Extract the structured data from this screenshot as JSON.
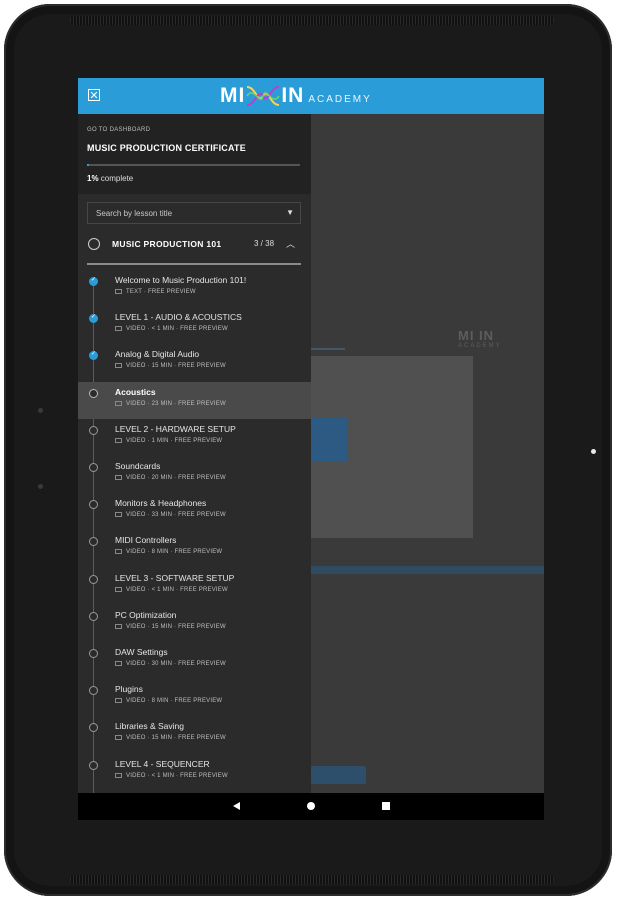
{
  "app": {
    "brand_left": "MI",
    "brand_right": "IN",
    "brand_suffix": "ACADEMY",
    "close_glyph": "✕",
    "accent_color": "#2a9dd9"
  },
  "sidebar": {
    "go_dashboard": "GO TO DASHBOARD",
    "course_title": "MUSIC PRODUCTION CERTIFICATE",
    "progress_percent": 1,
    "complete_value": "1%",
    "complete_label": " complete",
    "search_placeholder": "Search by lesson title",
    "section": {
      "title": "MUSIC PRODUCTION 101",
      "count": "3 / 38"
    },
    "lessons": [
      {
        "title": "Welcome to Music Production 101!",
        "meta": "TEXT · FREE PREVIEW",
        "done": true
      },
      {
        "title": "LEVEL 1 - AUDIO & ACOUSTICS",
        "meta": "VIDEO · < 1 MIN · FREE PREVIEW",
        "done": true
      },
      {
        "title": "Analog & Digital Audio",
        "meta": "VIDEO · 15 MIN · FREE PREVIEW",
        "done": true
      },
      {
        "title": "Acoustics",
        "meta": "VIDEO · 23 MIN · FREE PREVIEW",
        "done": false,
        "active": true
      },
      {
        "title": "LEVEL 2 - HARDWARE SETUP",
        "meta": "VIDEO · 1 MIN · FREE PREVIEW",
        "done": false
      },
      {
        "title": "Soundcards",
        "meta": "VIDEO · 20 MIN · FREE PREVIEW",
        "done": false
      },
      {
        "title": "Monitors & Headphones",
        "meta": "VIDEO · 33 MIN · FREE PREVIEW",
        "done": false
      },
      {
        "title": "MIDI Controllers",
        "meta": "VIDEO · 8 MIN · FREE PREVIEW",
        "done": false
      },
      {
        "title": "LEVEL 3 - SOFTWARE SETUP",
        "meta": "VIDEO · < 1 MIN · FREE PREVIEW",
        "done": false
      },
      {
        "title": "PC Optimization",
        "meta": "VIDEO · 15 MIN · FREE PREVIEW",
        "done": false
      },
      {
        "title": "DAW Settings",
        "meta": "VIDEO · 30 MIN · FREE PREVIEW",
        "done": false
      },
      {
        "title": "Plugins",
        "meta": "VIDEO · 8 MIN · FREE PREVIEW",
        "done": false
      },
      {
        "title": "Libraries & Saving",
        "meta": "VIDEO · 15 MIN · FREE PREVIEW",
        "done": false
      },
      {
        "title": "LEVEL 4 - SEQUENCER",
        "meta": "VIDEO · < 1 MIN · FREE PREVIEW",
        "done": false
      }
    ]
  },
  "background_page": {
    "logo_text": "MI  IN",
    "logo_sub": "ACADEMY"
  }
}
